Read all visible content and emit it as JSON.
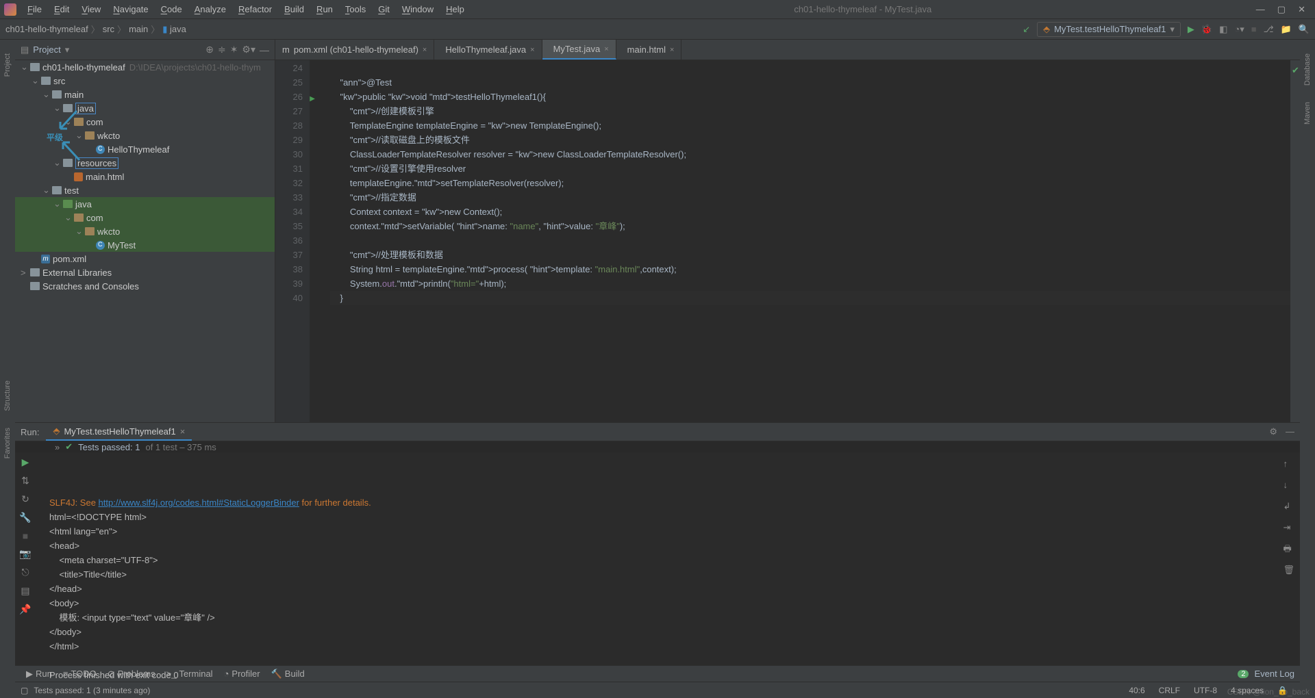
{
  "menubar": {
    "items": [
      "File",
      "Edit",
      "View",
      "Navigate",
      "Code",
      "Analyze",
      "Refactor",
      "Build",
      "Run",
      "Tools",
      "Git",
      "Window",
      "Help"
    ],
    "title": "ch01-hello-thymeleaf - MyTest.java"
  },
  "breadcrumbs": [
    "ch01-hello-thymeleaf",
    "src",
    "main",
    "java"
  ],
  "run_config": "MyTest.testHelloThymeleaf1",
  "project_pane": {
    "title": "Project",
    "tree": {
      "root": "ch01-hello-thymeleaf",
      "root_path": "D:\\IDEA\\projects\\ch01-hello-thym",
      "annot": "平级",
      "nodes": [
        {
          "depth": 0,
          "icon": "mod",
          "label": "ch01-hello-thymeleaf",
          "suffix": "D:\\IDEA\\projects\\ch01-hello-thym",
          "exp": true
        },
        {
          "depth": 1,
          "icon": "fld",
          "label": "src",
          "exp": true
        },
        {
          "depth": 2,
          "icon": "fld",
          "label": "main",
          "exp": true
        },
        {
          "depth": 3,
          "icon": "fld",
          "label": "java",
          "exp": true,
          "hl": true
        },
        {
          "depth": 4,
          "icon": "pkg",
          "label": "com",
          "exp": true
        },
        {
          "depth": 5,
          "icon": "pkg",
          "label": "wkcto",
          "exp": true
        },
        {
          "depth": 6,
          "icon": "java",
          "label": "HelloThymeleaf"
        },
        {
          "depth": 3,
          "icon": "fld",
          "label": "resources",
          "exp": true,
          "hl": true
        },
        {
          "depth": 4,
          "icon": "html",
          "label": "main.html"
        },
        {
          "depth": 2,
          "icon": "fld",
          "label": "test",
          "exp": true
        },
        {
          "depth": 3,
          "icon": "tst",
          "label": "java",
          "exp": true,
          "sel": true
        },
        {
          "depth": 4,
          "icon": "pkg",
          "label": "com",
          "exp": true,
          "sel": true
        },
        {
          "depth": 5,
          "icon": "pkg",
          "label": "wkcto",
          "exp": true,
          "sel": true
        },
        {
          "depth": 6,
          "icon": "java",
          "label": "MyTest",
          "sel": true
        },
        {
          "depth": 1,
          "icon": "m",
          "label": "pom.xml"
        },
        {
          "depth": 0,
          "icon": "lib",
          "label": "External Libraries",
          "exp": false,
          "arrow": ">"
        },
        {
          "depth": 0,
          "icon": "scratch",
          "label": "Scratches and Consoles"
        }
      ]
    }
  },
  "editor_tabs": [
    {
      "icon": "m",
      "label": "pom.xml (ch01-hello-thymeleaf)"
    },
    {
      "icon": "java",
      "label": "HelloThymeleaf.java"
    },
    {
      "icon": "java",
      "label": "MyTest.java",
      "active": true
    },
    {
      "icon": "html",
      "label": "main.html"
    }
  ],
  "code": {
    "first_line": 24,
    "run_marker_line": 26,
    "lines": [
      "",
      "    @Test",
      "    public void testHelloThymeleaf1(){",
      "        //创建模板引擎",
      "        TemplateEngine templateEngine = new TemplateEngine();",
      "        //读取磁盘上的模板文件",
      "        ClassLoaderTemplateResolver resolver = new ClassLoaderTemplateResolver();",
      "        //设置引擎使用resolver",
      "        templateEngine.setTemplateResolver(resolver);",
      "        //指定数据",
      "        Context context = new Context();",
      "        context.setVariable( name: \"name\", value: \"章峰\");",
      "",
      "        //处理模板和数据",
      "        String html = templateEngine.process( template: \"main.html\",context);",
      "        System.out.println(\"html=\"+html);",
      "    }"
    ]
  },
  "run_panel": {
    "label": "Run:",
    "tab": "MyTest.testHelloThymeleaf1",
    "status_prefix": "Tests passed: 1",
    "status_suffix": "of 1 test – 375 ms",
    "console": [
      {
        "t": "err",
        "text": "SLF4J: See http://www.slf4j.org/codes.html#StaticLoggerBinder for further details.",
        "link": "http://www.slf4j.org/codes.html#StaticLoggerBinder"
      },
      {
        "t": "",
        "text": "html=<!DOCTYPE html>"
      },
      {
        "t": "",
        "text": "<html lang=\"en\">"
      },
      {
        "t": "",
        "text": "<head>"
      },
      {
        "t": "",
        "text": "    <meta charset=\"UTF-8\">"
      },
      {
        "t": "",
        "text": "    <title>Title</title>"
      },
      {
        "t": "",
        "text": "</head>"
      },
      {
        "t": "",
        "text": "<body>"
      },
      {
        "t": "",
        "text": "    模板: <input type=\"text\" value=\"章峰\" />"
      },
      {
        "t": "",
        "text": "</body>"
      },
      {
        "t": "",
        "text": "</html>"
      },
      {
        "t": "",
        "text": ""
      },
      {
        "t": "",
        "text": "Process finished with exit code 0"
      }
    ]
  },
  "bottom_tabs": [
    {
      "icon": "▶",
      "label": "Run"
    },
    {
      "icon": "≡",
      "label": "TODO"
    },
    {
      "icon": "⊘",
      "label": "Problems"
    },
    {
      "icon": ">_",
      "label": "Terminal"
    },
    {
      "icon": "◔",
      "label": "Profiler"
    },
    {
      "icon": "🔨",
      "label": "Build"
    }
  ],
  "event_log": {
    "badge": "2",
    "label": "Event Log"
  },
  "statusbar": {
    "msg": "Tests passed: 1 (3 minutes ago)",
    "pos": "40:6",
    "le": "CRLF",
    "enc": "UTF-8",
    "indent": "4 spaces"
  },
  "left_rail": [
    "Project",
    "Structure",
    "Favorites"
  ],
  "right_rail": [
    "Database",
    "Maven"
  ],
  "watermark": "CSDN @lion_no_back"
}
